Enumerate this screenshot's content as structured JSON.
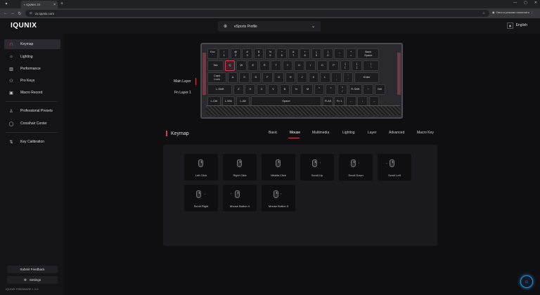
{
  "browser": {
    "tab_title": "IQUNIX ZX",
    "url": "zx.iqunix.com",
    "incognito_text": "Окно в режиме инкогнито"
  },
  "header": {
    "logo": "IQUNIX",
    "profile": "eSports Profile",
    "language": "English"
  },
  "sidebar": {
    "items": [
      {
        "label": "Keymap",
        "icon": "keymap-icon",
        "glyph": "⊓"
      },
      {
        "label": "Lighting",
        "icon": "lighting-icon",
        "glyph": "☼"
      },
      {
        "label": "Performance",
        "icon": "performance-icon",
        "glyph": "▥"
      },
      {
        "label": "Pro Keys",
        "icon": "pro-keys-icon",
        "glyph": "⚇"
      },
      {
        "label": "Macro Record",
        "icon": "macro-icon",
        "glyph": "▣"
      },
      {
        "label": "Professional Presets",
        "icon": "presets-icon",
        "glyph": "♙"
      },
      {
        "label": "Crosshair Center",
        "icon": "crosshair-icon",
        "glyph": "◯"
      },
      {
        "label": "Key Calibration",
        "icon": "calibration-icon",
        "glyph": "⇅"
      }
    ],
    "feedback": "Submit Feedback",
    "settings": "Settings",
    "version": "IQUNIX FIRMWARE 1.0.8"
  },
  "layers": {
    "main": "Main Layer",
    "fn": "Fn Layer 1"
  },
  "keyboard": {
    "row0": [
      "Esc\n`",
      "!\n1",
      "@\n2",
      "#\n3",
      "$\n4",
      "%\n5",
      "^\n6",
      "&\n7",
      "*\n8",
      "(\n9",
      ")\n0",
      "_\n-",
      "+\n=",
      "Back\nSpace"
    ],
    "row1": [
      "Tab",
      "Q",
      "W",
      "E",
      "R",
      "T",
      "Y",
      "U",
      "I",
      "O",
      "P",
      "{\n[",
      "}\n]",
      "|\n\\"
    ],
    "row2": [
      "Caps\nLock",
      "A",
      "S",
      "D",
      "F",
      "G",
      "H",
      "J",
      "K",
      "L",
      ":\n;",
      "\"\n'",
      "Enter"
    ],
    "row3": [
      "L-Shift",
      "Z",
      "X",
      "C",
      "V",
      "B",
      "N",
      "M",
      "<\n,",
      ">\n.",
      "?\n/",
      "R-Shift",
      "↑",
      "Del"
    ],
    "row4": [
      "L-Ctrl",
      "L-Win",
      "L-Alt",
      "Space",
      "R-Alt",
      "Fn 1",
      "←",
      "↓",
      "→"
    ]
  },
  "section": {
    "title": "Keymap",
    "tabs": [
      "Basic",
      "Mouse",
      "Multimedia",
      "Lighting",
      "Layer",
      "Advanced",
      "Macro Key"
    ]
  },
  "mouse_keys": [
    {
      "label": "Left Click",
      "arrow": ""
    },
    {
      "label": "Right Click",
      "arrow": ""
    },
    {
      "label": "Middle Click",
      "arrow": ""
    },
    {
      "label": "Scroll Up",
      "arrow": "↑"
    },
    {
      "label": "Scroll Down",
      "arrow": "↓"
    },
    {
      "label": "Scroll Left",
      "arrow": "←"
    },
    {
      "label": "Scroll Right",
      "arrow": "→"
    },
    {
      "label": "Mouse Button 4",
      "arrow": "‹"
    },
    {
      "label": "Mouse Button 5",
      "arrow": "›"
    }
  ],
  "colors": {
    "accent": "#d93b57",
    "fab": "#2a8cd0"
  }
}
